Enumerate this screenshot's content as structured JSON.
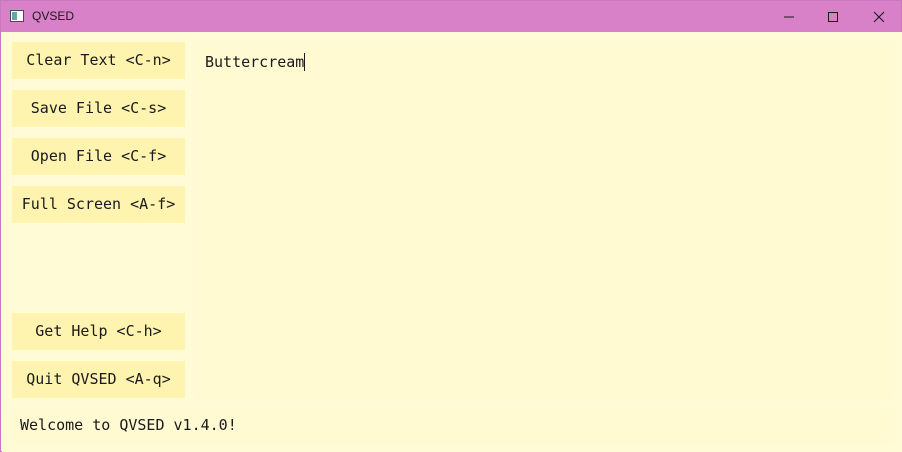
{
  "window": {
    "title": "QVSED"
  },
  "sidebar": {
    "buttons": [
      {
        "label": "Clear Text <C-n>"
      },
      {
        "label": "Save File <C-s>"
      },
      {
        "label": "Open File <C-f>"
      },
      {
        "label": "Full Screen <A-f>"
      },
      {
        "label": "Get Help <C-h>"
      },
      {
        "label": "Quit QVSED <A-q>"
      }
    ]
  },
  "editor": {
    "text": "Buttercream"
  },
  "status": {
    "message": "Welcome to QVSED v1.4.0!"
  },
  "icons": {
    "app": "app-window-icon",
    "minimize": "minimize-icon",
    "maximize": "maximize-icon",
    "close": "close-icon"
  },
  "colors": {
    "titlebar": "#d880c8",
    "background": "#fffbd6",
    "button": "#fff3b0",
    "text": "#1a1a1a"
  }
}
